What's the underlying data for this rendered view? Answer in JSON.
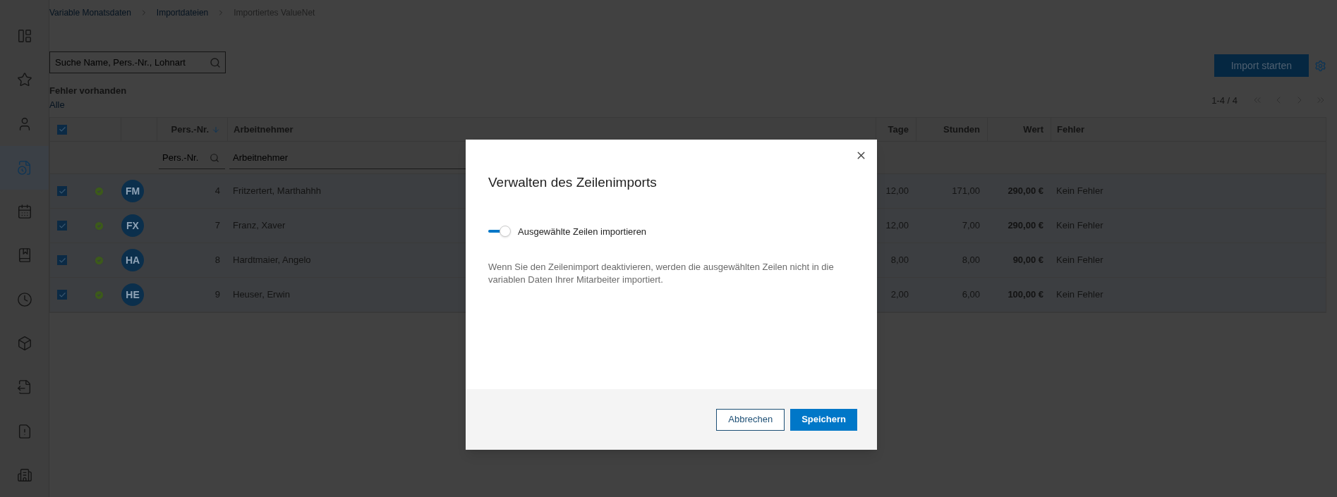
{
  "sidebar": {
    "items": [
      {
        "selected": false
      },
      {
        "selected": false
      },
      {
        "selected": false
      },
      {
        "selected": true
      },
      {
        "selected": false
      },
      {
        "selected": false
      },
      {
        "selected": false
      },
      {
        "selected": false
      },
      {
        "selected": false
      },
      {
        "selected": false
      },
      {
        "selected": false
      }
    ]
  },
  "breadcrumb": [
    {
      "label": "Variable Monatsdaten",
      "link": true
    },
    {
      "label": "Importdateien",
      "link": true
    },
    {
      "label": "Importiertes ValueNet",
      "link": false
    }
  ],
  "search": {
    "placeholder": "Suche Name, Pers.-Nr., Lohnart"
  },
  "import_button": "Import starten",
  "filter": {
    "label": "Fehler vorhanden",
    "value": "Alle"
  },
  "pagination": {
    "range": "1-4 / 4"
  },
  "table": {
    "all_checked": true,
    "columns": [
      {
        "label": "Pers.-Nr.",
        "sort_descending": true,
        "filter_placeholder": "Pers.-Nr."
      },
      {
        "label": "Arbeitnehmer",
        "filter_placeholder": "Arbeitnehmer"
      },
      {
        "label": "Tage"
      },
      {
        "label": "Stunden"
      },
      {
        "label": "Wert"
      },
      {
        "label": "Fehler"
      }
    ],
    "rows": [
      {
        "selected": true,
        "ok": true,
        "initials": "FM",
        "nr": "4",
        "name": "Fritzertert, Marthahhh",
        "tage": "12,00",
        "stunden": "171,00",
        "wert": "290,00 €",
        "fehler": "Kein Fehler"
      },
      {
        "selected": true,
        "ok": true,
        "initials": "FX",
        "nr": "7",
        "name": "Franz, Xaver",
        "tage": "12,00",
        "stunden": "7,00",
        "wert": "290,00 €",
        "fehler": "Kein Fehler"
      },
      {
        "selected": true,
        "ok": true,
        "initials": "HA",
        "nr": "8",
        "name": "Hardtmaier, Angelo",
        "tage": "8,00",
        "stunden": "8,00",
        "wert": "90,00 €",
        "fehler": "Kein Fehler"
      },
      {
        "selected": true,
        "ok": true,
        "initials": "HE",
        "nr": "9",
        "name": "Heuser, Erwin",
        "tage": "2,00",
        "stunden": "6,00",
        "wert": "100,00 €",
        "fehler": "Kein Fehler"
      }
    ]
  },
  "modal": {
    "title": "Verwalten des Zeilenimports",
    "toggle": {
      "label": "Ausgewählte Zeilen importieren",
      "on": true
    },
    "description": "Wenn Sie den Zeilenimport deaktivieren, werden die ausgewählten Zeilen nicht in die variablen Daten Ihrer Mitarbeiter importiert.",
    "buttons": [
      {
        "label": "Abbrechen",
        "primary": false
      },
      {
        "label": "Speichern",
        "primary": true
      }
    ]
  }
}
